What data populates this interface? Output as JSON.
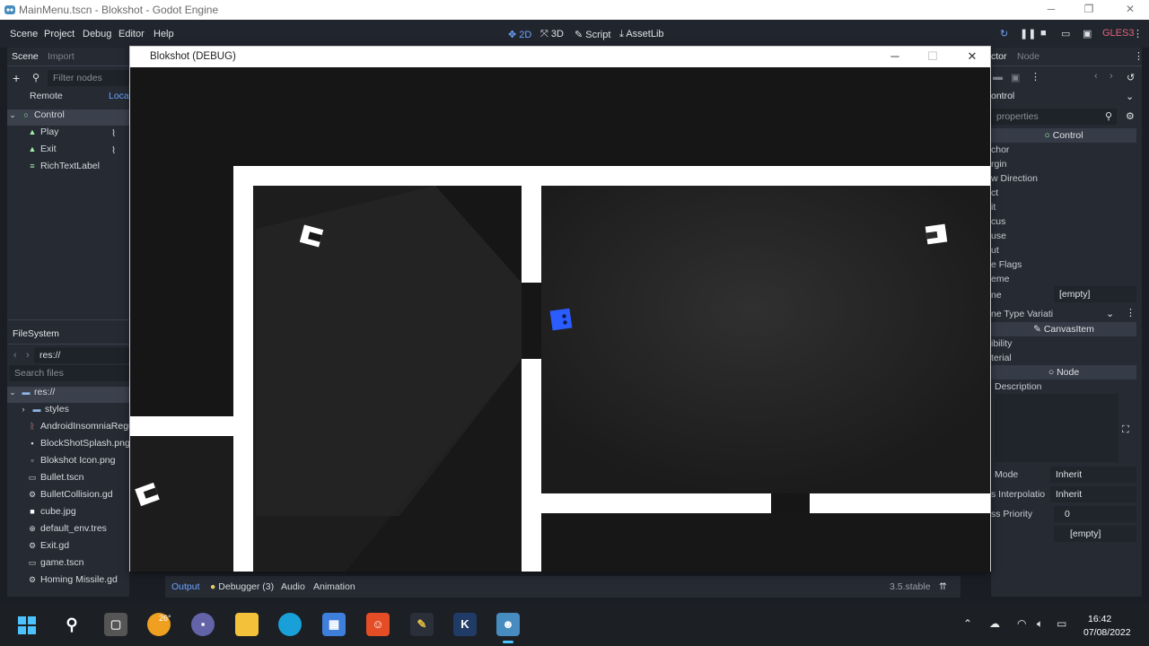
{
  "os_window": {
    "title": "MainMenu.tscn - Blokshot - Godot Engine",
    "icon": "godot-icon"
  },
  "menubar": {
    "menus": [
      "Scene",
      "Project",
      "Debug",
      "Editor",
      "Help"
    ],
    "workspaces": [
      {
        "label": "2D",
        "icon": "2d-icon",
        "active": true
      },
      {
        "label": "3D",
        "icon": "3d-icon",
        "active": false
      },
      {
        "label": "Script",
        "icon": "script-icon",
        "active": false
      },
      {
        "label": "AssetLib",
        "icon": "assetlib-icon",
        "active": false
      }
    ],
    "renderer": "GLES3"
  },
  "scene_dock": {
    "tabs": [
      "Scene",
      "Import"
    ],
    "filter_placeholder": "Filter nodes",
    "remote_label": "Remote",
    "local_label": "Local",
    "nodes": [
      {
        "label": "Control",
        "icon": "control-icon",
        "depth": 0
      },
      {
        "label": "Play",
        "icon": "button-icon",
        "depth": 1
      },
      {
        "label": "Exit",
        "icon": "button-icon",
        "depth": 1
      },
      {
        "label": "RichTextLabel",
        "icon": "richtextlabel-icon",
        "depth": 1
      }
    ]
  },
  "filesystem_dock": {
    "title": "FileSystem",
    "path": "res://",
    "search_placeholder": "Search files",
    "items": [
      {
        "label": "res://",
        "icon": "folder-icon",
        "depth": 0
      },
      {
        "label": "styles",
        "icon": "folder-icon",
        "depth": 1
      },
      {
        "label": "AndroidInsomniaRegu",
        "icon": "font-icon",
        "depth": 1
      },
      {
        "label": "BlockShotSplash.png",
        "icon": "image-icon",
        "depth": 1
      },
      {
        "label": "Blokshot Icon.png",
        "icon": "image-icon",
        "depth": 1
      },
      {
        "label": "Bullet.tscn",
        "icon": "scene-icon",
        "depth": 1
      },
      {
        "label": "BulletCollision.gd",
        "icon": "gear-icon",
        "depth": 1
      },
      {
        "label": "cube.jpg",
        "icon": "image-icon",
        "depth": 1
      },
      {
        "label": "default_env.tres",
        "icon": "globe-icon",
        "depth": 1
      },
      {
        "label": "Exit.gd",
        "icon": "gear-icon",
        "depth": 1
      },
      {
        "label": "game.tscn",
        "icon": "scene-icon",
        "depth": 1
      },
      {
        "label": "Homing Missile.gd",
        "icon": "gear-icon",
        "depth": 1
      }
    ]
  },
  "inspector_dock": {
    "tabs": [
      "ctor",
      "Node"
    ],
    "object": "ontrol",
    "filter_placeholder": "properties",
    "section_control": "Control",
    "control_props": [
      "chor",
      "rgin",
      "w Direction",
      "ct",
      "it",
      "cus",
      "use",
      "ut",
      "e Flags",
      "eme"
    ],
    "theme_label": "ne",
    "theme_value": "[empty]",
    "theme_type_label": "ne Type Variati",
    "section_canvasitem": "CanvasItem",
    "canvas_props": [
      "ibility",
      "terial"
    ],
    "section_node": "Node",
    "description_label": "Description",
    "node_props": [
      {
        "label": "Mode",
        "value": "Inherit"
      },
      {
        "label": "s Interpolatio",
        "value": "Inherit"
      },
      {
        "label": "ss Priority",
        "value": "0"
      }
    ],
    "last_value": "[empty]"
  },
  "bottom_panel": {
    "tabs": [
      "Output",
      "Debugger (3)",
      "Audio",
      "Animation"
    ],
    "version": "3.5.stable"
  },
  "game_window": {
    "title": "Blokshot (DEBUG)"
  },
  "taskbar": {
    "weather_temp": "26°",
    "time": "16:42",
    "date": "07/08/2022",
    "k_label": "K"
  }
}
